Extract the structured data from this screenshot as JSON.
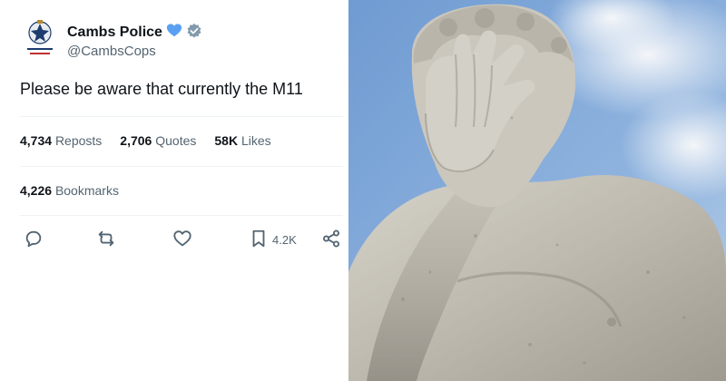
{
  "tweet": {
    "display_name": "Cambs Police",
    "handle": "@CambsCops",
    "text": "Please be aware that currently the M11",
    "badge_heart_color": "#5aa0f2",
    "verified_color": "#829aab",
    "stats": {
      "reposts": "4,734",
      "reposts_label": "Reposts",
      "quotes": "2,706",
      "quotes_label": "Quotes",
      "likes": "58K",
      "likes_label": "Likes",
      "bookmarks": "4,226",
      "bookmarks_label": "Bookmarks"
    },
    "actions": {
      "reply_icon": "reply-icon",
      "repost_icon": "repost-icon",
      "like_icon": "heart-icon",
      "bookmark_icon": "bookmark-icon",
      "bookmark_count": "4.2K",
      "share_icon": "share-icon"
    }
  },
  "photo": {
    "subject": "facepalm-statue",
    "sky_color": "#7ea6d8",
    "stone_color": "#c9c6bd"
  }
}
